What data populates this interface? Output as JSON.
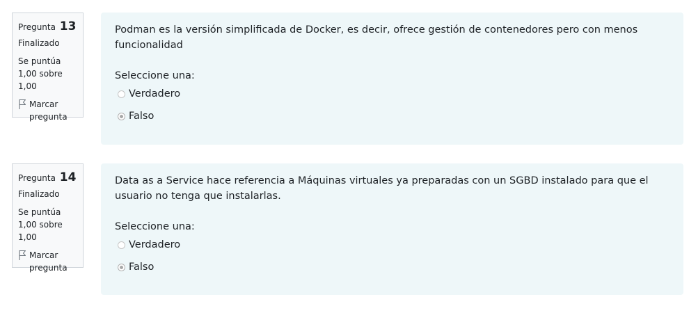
{
  "questions": [
    {
      "label": "Pregunta",
      "number": "13",
      "state": "Finalizado",
      "grade": "Se puntúa 1,00 sobre 1,00",
      "flag_label": "Marcar pregunta",
      "text": "Podman es la versión simplificada de Docker, es decir, ofrece gestión de contenedores pero con menos funcionalidad",
      "prompt": "Seleccione una:",
      "options": [
        "Verdadero",
        "Falso"
      ],
      "selected": "Falso"
    },
    {
      "label": "Pregunta",
      "number": "14",
      "state": "Finalizado",
      "grade": "Se puntúa 1,00 sobre 1,00",
      "flag_label": "Marcar pregunta",
      "text": "Data as a Service hace referencia a Máquinas virtuales ya preparadas con un SGBD instalado para que el usuario no tenga que instalarlas.",
      "prompt": "Seleccione una:",
      "options": [
        "Verdadero",
        "Falso"
      ],
      "selected": "Falso"
    }
  ]
}
